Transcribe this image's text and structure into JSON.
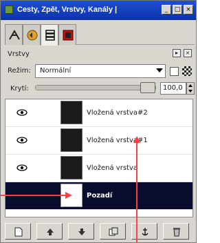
{
  "window": {
    "title": "Cesty, Zpět, Vrstvy, Kanály |",
    "minimize_glyph": "_",
    "maximize_glyph": "□",
    "close_glyph": "×"
  },
  "tabs": [
    {
      "icon": "paths-icon"
    },
    {
      "icon": "undo-icon"
    },
    {
      "icon": "layers-icon"
    },
    {
      "icon": "channels-icon"
    }
  ],
  "panel": {
    "label": "Vrstvy",
    "mode_label": "Režim:",
    "mode_value": "Normální",
    "opacity_label": "Krytí:",
    "opacity_value": "100,0",
    "opacity_fraction": 1.0
  },
  "layers": [
    {
      "name": "Vložená vrstva#2",
      "visible": true,
      "selected": false
    },
    {
      "name": "Vložená vrstva#1",
      "visible": true,
      "selected": false
    },
    {
      "name": "Vložená vrstva",
      "visible": true,
      "selected": false
    },
    {
      "name": "Pozadí",
      "visible": false,
      "selected": true
    }
  ],
  "toolbar": [
    {
      "icon": "new-layer-icon"
    },
    {
      "icon": "raise-layer-icon"
    },
    {
      "icon": "lower-layer-icon"
    },
    {
      "icon": "duplicate-layer-icon"
    },
    {
      "icon": "anchor-layer-icon"
    },
    {
      "icon": "delete-layer-icon"
    }
  ],
  "colors": {
    "titlebar": "#0a31a8",
    "selected_row": "#0a0c2e",
    "annotation": "#ff4040"
  }
}
